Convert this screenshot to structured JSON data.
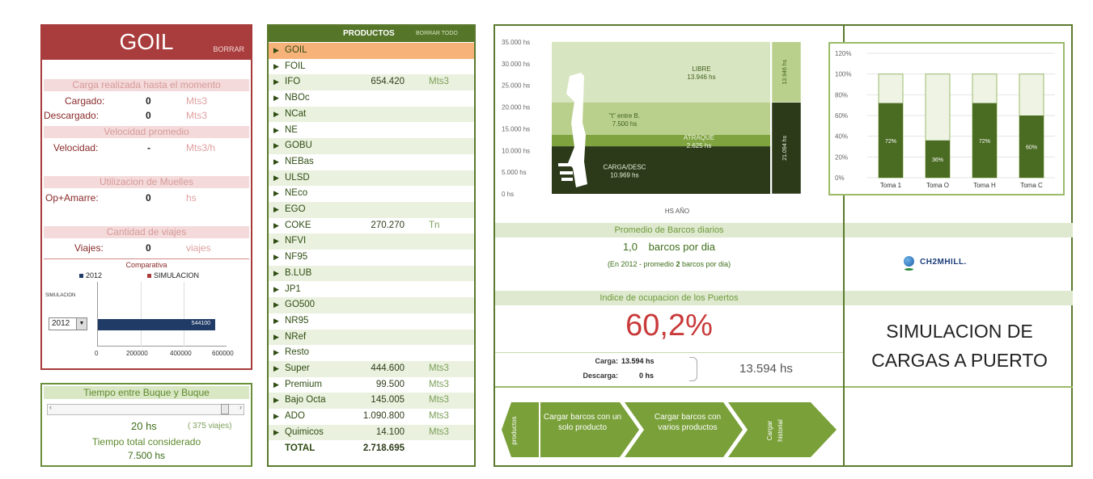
{
  "goil": {
    "title": "GOIL",
    "borrar": "BORRAR",
    "carga_section": "Carga realizada hasta el momento",
    "cargado_label": "Cargado:",
    "cargado_value": "0",
    "cargado_unit": "Mts3",
    "descargado_label": "Descargado:",
    "descargado_value": "0",
    "descargado_unit": "Mts3",
    "velocidad_section": "Velocidad promedio",
    "velocidad_label": "Velocidad:",
    "velocidad_value": "-",
    "velocidad_unit": "Mts3/h",
    "muelles_section": "Utilizacion de Muelles",
    "op_label": "Op+Amarre:",
    "op_value": "0",
    "op_unit": "hs",
    "viajes_section": "Cantidad de viajes",
    "viajes_label": "Viajes:",
    "viajes_value": "0",
    "viajes_unit": "viajes",
    "comparativa_title": "Comparativa",
    "legend_2012": "2012",
    "legend_sim": "SIMULACION",
    "sim_axis_label": "SIMULACION",
    "year_select": "2012",
    "bar_label": "544100",
    "x_ticks": [
      "0",
      "200000",
      "400000",
      "600000"
    ],
    "bar_value": 544100,
    "x_max": 600000,
    "color_2012": "#1f3b66",
    "color_sim": "#a93c3c"
  },
  "tiempo": {
    "header": "Tiempo entre Buque y Buque",
    "value": "20 hs",
    "viajes_note": "( 375 viajes)",
    "total_label": "Tiempo total considerado",
    "total_value": "7.500 hs"
  },
  "productos": {
    "title": "PRODUCTOS",
    "borrar_todo": "BORRAR TODO",
    "rows": [
      {
        "name": "GOIL",
        "qty": "",
        "unit": ""
      },
      {
        "name": "FOIL",
        "qty": "",
        "unit": ""
      },
      {
        "name": "IFO",
        "qty": "654.420",
        "unit": "Mts3"
      },
      {
        "name": "NBOc",
        "qty": "",
        "unit": ""
      },
      {
        "name": "NCat",
        "qty": "",
        "unit": ""
      },
      {
        "name": "NE",
        "qty": "",
        "unit": ""
      },
      {
        "name": "GOBU",
        "qty": "",
        "unit": ""
      },
      {
        "name": "NEBas",
        "qty": "",
        "unit": ""
      },
      {
        "name": "ULSD",
        "qty": "",
        "unit": ""
      },
      {
        "name": "NEco",
        "qty": "",
        "unit": ""
      },
      {
        "name": "EGO",
        "qty": "",
        "unit": ""
      },
      {
        "name": "COKE",
        "qty": "270.270",
        "unit": "Tn"
      },
      {
        "name": "NFVI",
        "qty": "",
        "unit": ""
      },
      {
        "name": "NF95",
        "qty": "",
        "unit": ""
      },
      {
        "name": "B.LUB",
        "qty": "",
        "unit": ""
      },
      {
        "name": "JP1",
        "qty": "",
        "unit": ""
      },
      {
        "name": "GO500",
        "qty": "",
        "unit": ""
      },
      {
        "name": "NR95",
        "qty": "",
        "unit": ""
      },
      {
        "name": "NRef",
        "qty": "",
        "unit": ""
      },
      {
        "name": "Resto",
        "qty": "",
        "unit": ""
      },
      {
        "name": "Super",
        "qty": "444.600",
        "unit": "Mts3"
      },
      {
        "name": "Premium",
        "qty": "99.500",
        "unit": "Mts3"
      },
      {
        "name": "Bajo Octa",
        "qty": "145.005",
        "unit": "Mts3"
      },
      {
        "name": "ADO",
        "qty": "1.090.800",
        "unit": "Mts3"
      },
      {
        "name": "Quimicos",
        "qty": "14.100",
        "unit": "Mts3"
      }
    ],
    "total_label": "TOTAL",
    "total_qty": "2.718.695",
    "selected_color": "#f7b27a"
  },
  "chart_data": [
    {
      "type": "bar",
      "title": "",
      "xlabel": "HS AÑO",
      "ylabel": "",
      "ylim": [
        0,
        35000
      ],
      "y_ticks": [
        "0 hs",
        "5.000 hs",
        "10.000 hs",
        "15.000 hs",
        "20.000 hs",
        "25.000 hs",
        "30.000 hs",
        "35.000 hs"
      ],
      "stack_labels": [
        {
          "label": "CARGA/DESC",
          "value_text": "10.969 hs",
          "value": 10969
        },
        {
          "label": "ATRAQUE",
          "value_text": "2.625 hs",
          "value": 2625
        },
        {
          "label": "\"t\" entre B.",
          "value_text": "7.500 hs",
          "value": 7500
        },
        {
          "label": "LIBRE",
          "value_text": "13.946 hs",
          "value": 13946
        }
      ],
      "side_bar": [
        {
          "label": "21.094 hs",
          "value": 21094
        },
        {
          "label": "13.946 hs",
          "value": 13946
        }
      ]
    },
    {
      "type": "bar",
      "categories": [
        "Toma 1",
        "Toma O",
        "Toma H",
        "Toma C"
      ],
      "values": [
        72,
        36,
        72,
        60
      ],
      "labels": [
        "72%",
        "36%",
        "72%",
        "60%"
      ],
      "y_ticks": [
        "0%",
        "20%",
        "40%",
        "60%",
        "80%",
        "100%",
        "120%"
      ],
      "ylim": [
        0,
        120
      ]
    }
  ],
  "main": {
    "barcos_header": "Promedio de Barcos diarios",
    "barcos_value": "1,0",
    "barcos_unit": "barcos por dia",
    "barcos_note_pre": "(En 2012 - promedio",
    "barcos_note_num": "2",
    "barcos_note_post": "barcos por dia)",
    "indice_header": "Indice de ocupacion de los Puertos",
    "indice_value": "60,2%",
    "carga_label": "Carga:",
    "carga_value": "13.594 hs",
    "descarga_label": "Descarga:",
    "descarga_value": "0 hs",
    "total_hs": "13.594 hs",
    "btn_productos": "productos",
    "btn_un_solo": "Cargar barcos con un solo producto",
    "btn_varios": "Cargar barcos con varios productos",
    "btn_historial": "Cargar historial",
    "logo_text": "CH2MHILL.",
    "sim_title_1": "SIMULACION DE",
    "sim_title_2": "CARGAS A PUERTO"
  }
}
